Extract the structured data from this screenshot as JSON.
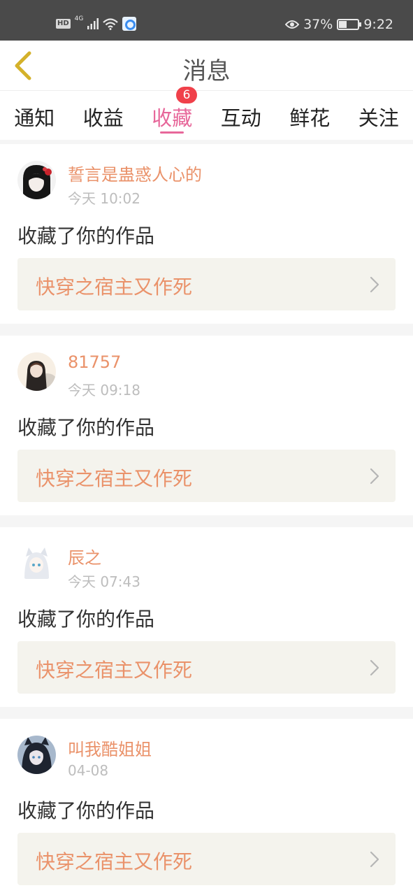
{
  "status_bar": {
    "hd": "HD",
    "network": "4G",
    "battery_percent": "37%",
    "battery_level": 0.37,
    "time": "9:22",
    "icons": [
      "signal-icon",
      "wifi-icon",
      "app-notification-icon",
      "eye-icon",
      "battery-icon"
    ]
  },
  "header": {
    "title": "消息",
    "back_icon": "chevron-left-icon"
  },
  "tabs": [
    {
      "label": "通知"
    },
    {
      "label": "收益"
    },
    {
      "label": "收藏",
      "active": true,
      "badge": "6"
    },
    {
      "label": "互动"
    },
    {
      "label": "鲜花"
    },
    {
      "label": "关注"
    }
  ],
  "feed": [
    {
      "user": "誓言是蛊惑人心的",
      "time": "今天 10:02",
      "action": "收藏了你的作品",
      "work": "快穿之宿主又作死"
    },
    {
      "user": "81757",
      "time": "今天 09:18",
      "action": "收藏了你的作品",
      "work": "快穿之宿主又作死"
    },
    {
      "user": "辰之",
      "time": "今天 07:43",
      "action": "收藏了你的作品",
      "work": "快穿之宿主又作死"
    },
    {
      "user": "叫我酷姐姐",
      "time": "04-08",
      "action": "收藏了你的作品",
      "work": "快穿之宿主又作死"
    }
  ],
  "colors": {
    "accent": "#e7679a",
    "username": "#ea926a",
    "badge": "#f0404a",
    "card_bg": "#f4f3ed",
    "back_icon": "#d4b12a"
  }
}
